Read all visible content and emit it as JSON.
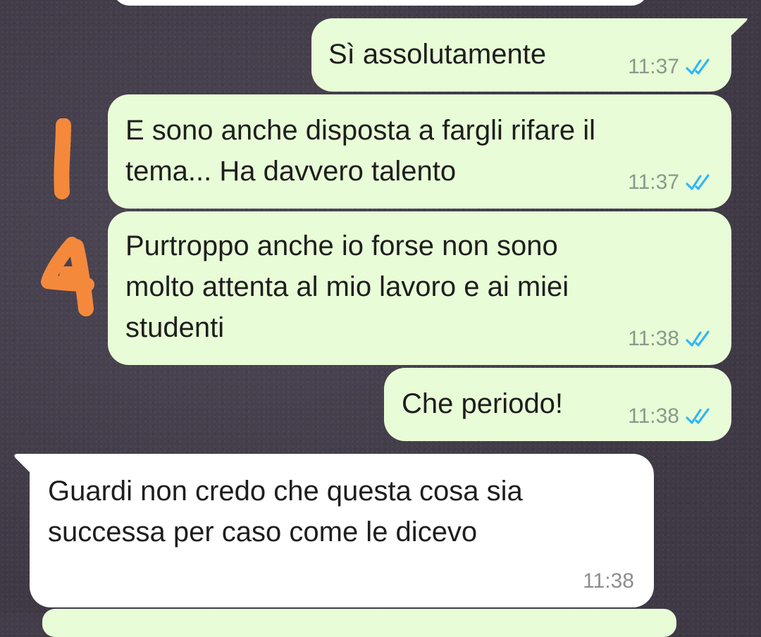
{
  "messages": [
    {
      "direction": "outgoing",
      "text": "Sì assolutamente",
      "time": "11:37",
      "status_icon": "double-check-read-icon"
    },
    {
      "direction": "outgoing",
      "text": "E sono anche disposta a fargli rifare il\ntema... Ha davvero talento",
      "time": "11:37",
      "status_icon": "double-check-read-icon"
    },
    {
      "direction": "outgoing",
      "text": "Purtroppo anche io forse non sono\nmolto attenta al mio lavoro e ai miei\nstudenti",
      "time": "11:38",
      "status_icon": "double-check-read-icon"
    },
    {
      "direction": "outgoing",
      "text": "Che periodo!",
      "time": "11:38",
      "status_icon": "double-check-read-icon"
    },
    {
      "direction": "incoming",
      "text": "Guardi non credo che questa cosa sia\nsuccessa per caso come le dicevo",
      "time": "11:38"
    }
  ],
  "colors": {
    "outgoing_bubble": "#e8fcd7",
    "incoming_bubble": "#ffffff",
    "read_ticks": "#34b7f1",
    "annotation_marks": "#f4893c"
  }
}
